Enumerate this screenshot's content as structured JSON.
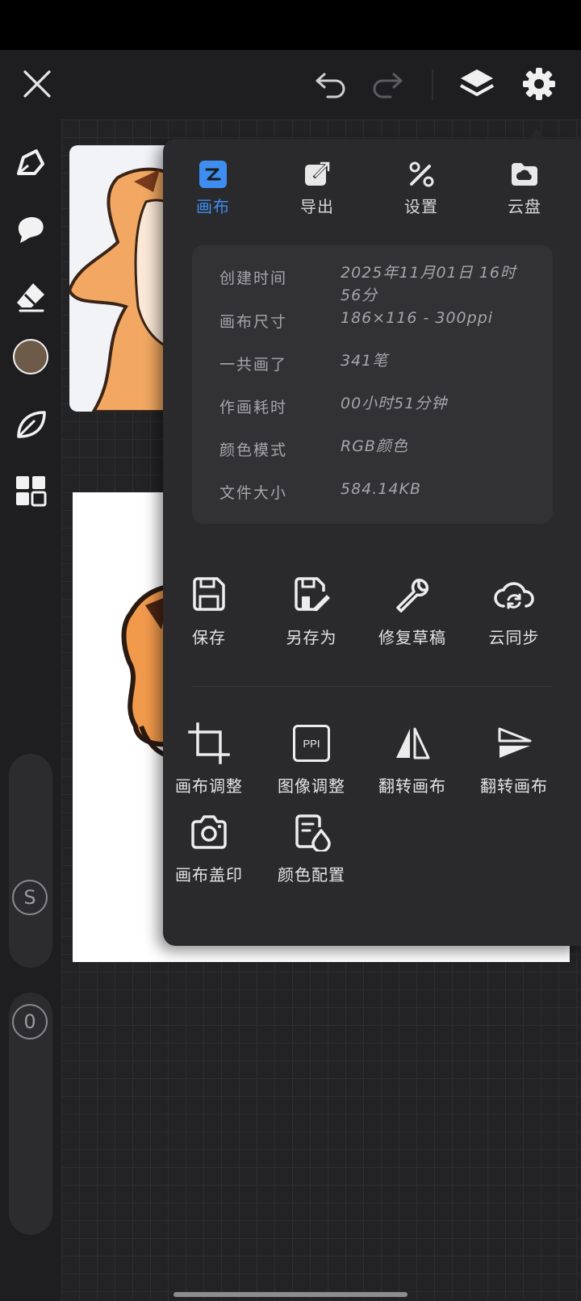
{
  "toolbar": {
    "close_icon": "close-icon",
    "undo_icon": "undo-icon",
    "redo_icon": "redo-icon",
    "layers_icon": "layers-icon",
    "settings_icon": "gear-icon"
  },
  "sidebar": {
    "tools": [
      "pen-tool-icon",
      "smudge-tool-icon",
      "eraser-icon",
      "color-swatch",
      "leaf-brush-icon",
      "grid-menu-icon"
    ],
    "current_color": "#6e5a48",
    "size_label": "S",
    "opacity_label": "0"
  },
  "panel": {
    "tabs": [
      {
        "label": "画布",
        "icon": "canvas-icon",
        "active": true
      },
      {
        "label": "导出",
        "icon": "export-icon",
        "active": false
      },
      {
        "label": "设置",
        "icon": "tools-icon",
        "active": false
      },
      {
        "label": "云盘",
        "icon": "cloud-drive-icon",
        "active": false
      }
    ],
    "info": [
      {
        "key": "创建时间",
        "value": "2025年11月01日 16时56分"
      },
      {
        "key": "画布尺寸",
        "value": "186×116 - 300ppi"
      },
      {
        "key": "一共画了",
        "value": "341笔"
      },
      {
        "key": "作画耗时",
        "value": "00小时51分钟"
      },
      {
        "key": "颜色模式",
        "value": "RGB颜色"
      },
      {
        "key": "文件大小",
        "value": "584.14KB"
      }
    ],
    "actions_row1": [
      {
        "label": "保存",
        "icon": "save-icon"
      },
      {
        "label": "另存为",
        "icon": "save-as-icon"
      },
      {
        "label": "修复草稿",
        "icon": "wrench-icon"
      },
      {
        "label": "云同步",
        "icon": "cloud-sync-icon"
      }
    ],
    "actions_row2": [
      {
        "label": "画布调整",
        "icon": "crop-icon"
      },
      {
        "label": "图像调整",
        "icon": "ppi-icon",
        "icon_text": "PPI"
      },
      {
        "label": "翻转画布",
        "icon": "flip-horizontal-icon"
      },
      {
        "label": "翻转画布",
        "icon": "flip-vertical-icon"
      }
    ],
    "actions_row3": [
      {
        "label": "画布盖印",
        "icon": "camera-icon"
      },
      {
        "label": "颜色配置",
        "icon": "color-profile-icon"
      }
    ]
  },
  "colors": {
    "accent": "#3d8ef0",
    "panel_bg": "#2a2a2d",
    "app_bg": "#1e1e20"
  }
}
